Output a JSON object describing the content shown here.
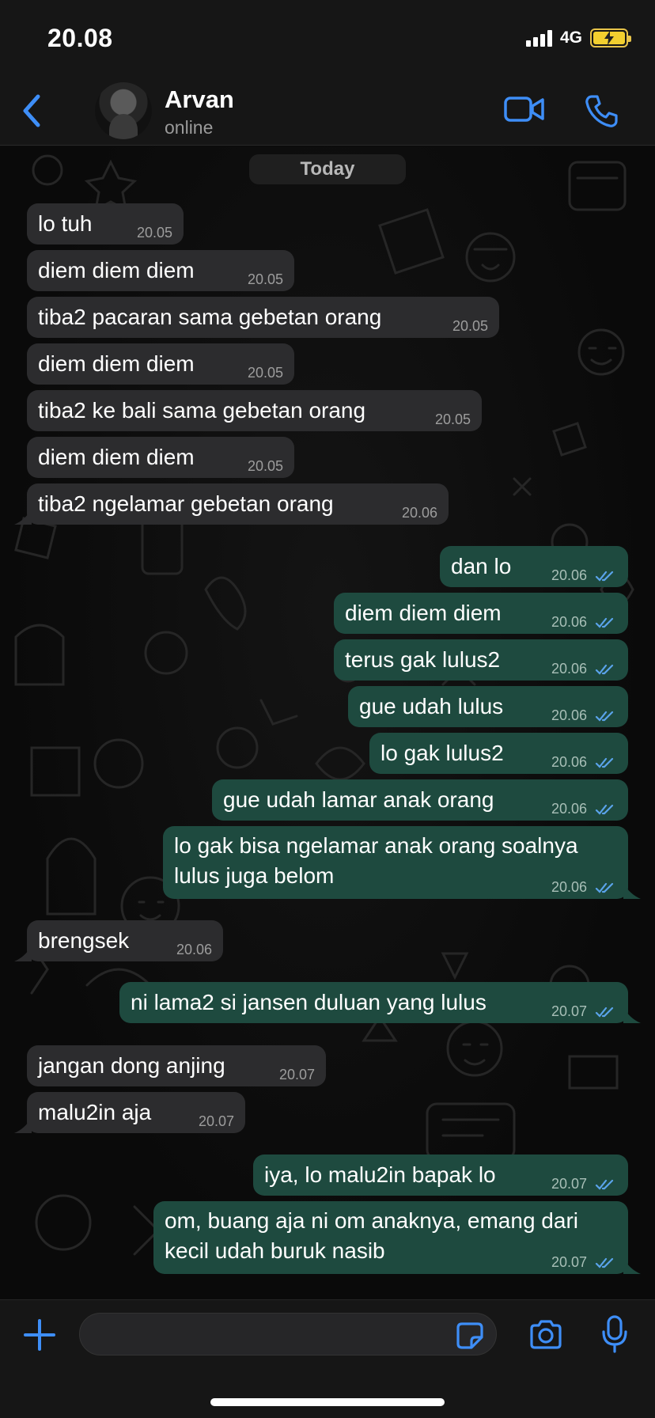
{
  "status_bar": {
    "time": "20.08",
    "network": "4G"
  },
  "header": {
    "contact_name": "Arvan",
    "status": "online"
  },
  "day_label": "Today",
  "messages": [
    {
      "dir": "in",
      "text": "lo tuh",
      "time": "20.05"
    },
    {
      "dir": "in",
      "text": "diem diem diem",
      "time": "20.05"
    },
    {
      "dir": "in",
      "text": "tiba2 pacaran sama gebetan orang",
      "time": "20.05"
    },
    {
      "dir": "in",
      "text": "diem diem diem",
      "time": "20.05"
    },
    {
      "dir": "in",
      "text": "tiba2 ke bali sama gebetan orang",
      "time": "20.05"
    },
    {
      "dir": "in",
      "text": "diem diem diem",
      "time": "20.05"
    },
    {
      "dir": "in",
      "text": "tiba2 ngelamar gebetan orang",
      "time": "20.06"
    },
    {
      "dir": "out",
      "text": "dan lo",
      "time": "20.06"
    },
    {
      "dir": "out",
      "text": "diem diem diem",
      "time": "20.06"
    },
    {
      "dir": "out",
      "text": "terus gak lulus2",
      "time": "20.06"
    },
    {
      "dir": "out",
      "text": "gue udah lulus",
      "time": "20.06"
    },
    {
      "dir": "out",
      "text": "lo gak lulus2",
      "time": "20.06"
    },
    {
      "dir": "out",
      "text": "gue udah lamar anak orang",
      "time": "20.06"
    },
    {
      "dir": "out",
      "text_line1": "lo gak bisa ngelamar anak orang soalnya",
      "text_line2": "lulus juga belom",
      "time": "20.06"
    },
    {
      "dir": "in",
      "text": "brengsek",
      "time": "20.06"
    },
    {
      "dir": "out",
      "text": "ni lama2 si jansen duluan yang lulus",
      "time": "20.07"
    },
    {
      "dir": "in",
      "text": "jangan dong anjing",
      "time": "20.07"
    },
    {
      "dir": "in",
      "text": "malu2in aja",
      "time": "20.07"
    },
    {
      "dir": "out",
      "text": "iya, lo malu2in bapak lo",
      "time": "20.07"
    },
    {
      "dir": "out",
      "text_line1": "om, buang aja ni om anaknya, emang dari",
      "text_line2": "kecil udah buruk nasib",
      "time": "20.07"
    }
  ],
  "colors": {
    "accent": "#3e8ef7",
    "incoming_bubble": "#2c2c2e",
    "outgoing_bubble": "#1e4a3f",
    "read_ticks": "#5aa3ea"
  },
  "icons": [
    "back-chevron-icon",
    "video-call-icon",
    "phone-call-icon",
    "plus-icon",
    "sticker-icon",
    "camera-icon",
    "microphone-icon"
  ]
}
